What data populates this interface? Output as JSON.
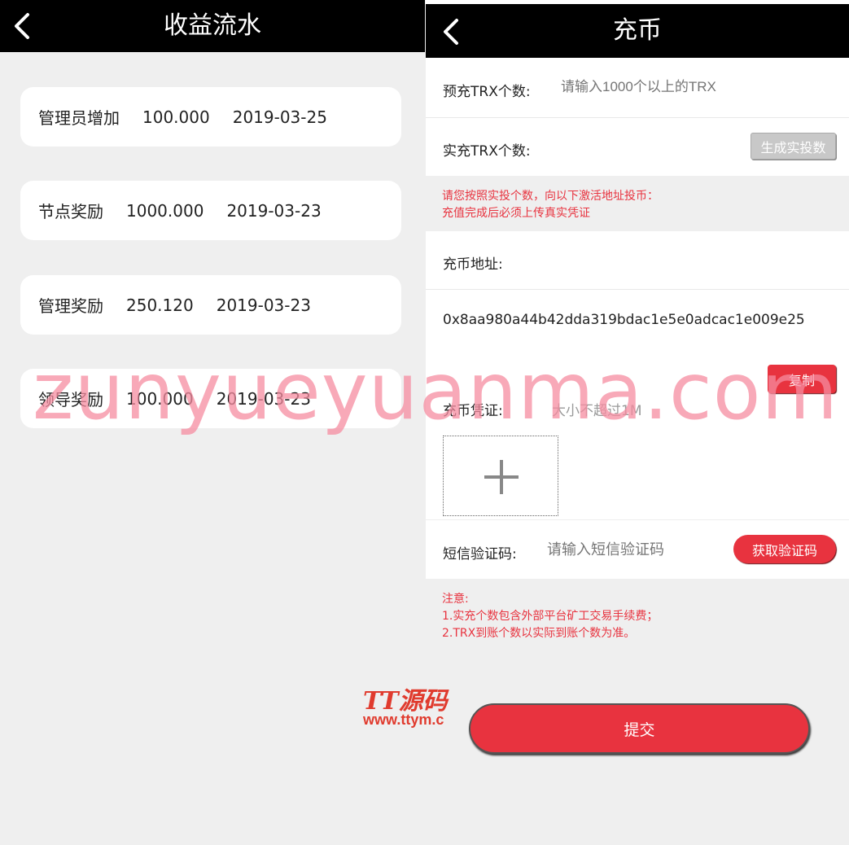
{
  "left": {
    "title": "收益流水",
    "records": [
      {
        "type": "管理员增加",
        "amount": "100.000",
        "date": "2019-03-25"
      },
      {
        "type": "节点奖励",
        "amount": "1000.000",
        "date": "2019-03-23"
      },
      {
        "type": "管理奖励",
        "amount": "250.120",
        "date": "2019-03-23"
      },
      {
        "type": "领导奖励",
        "amount": "100.000",
        "date": "2019-03-23"
      }
    ]
  },
  "right": {
    "title": "充币",
    "prefill_label": "预充TRX个数:",
    "prefill_placeholder": "请输入1000个以上的TRX",
    "actual_label": "实充TRX个数:",
    "generate_button": "生成实投数",
    "hint_lines": [
      "请您按照实投个数，向以下激活地址投币：",
      "充值完成后必须上传真实凭证"
    ],
    "address_label": "充币地址:",
    "address_value": "0x8aa980a44b42dda319bdac1e5e0adcac1e009e25",
    "copy_button": "复制",
    "voucher_label": "充币凭证:",
    "voucher_hint": "大小不超过1M",
    "sms_label": "短信验证码:",
    "sms_placeholder": "请输入短信验证码",
    "sms_button": "获取验证码",
    "notes": [
      "注意:",
      "1.实充个数包含外部平台矿工交易手续费；",
      "2.TRX到账个数以实际到账个数为准。"
    ],
    "submit_button": "提交"
  },
  "watermarks": {
    "main": "zunyueyuanma.com",
    "logo": "TT源码",
    "url": "www.ttym.c"
  },
  "icons": {
    "back": "chevron-left-icon",
    "upload": "plus-icon"
  }
}
